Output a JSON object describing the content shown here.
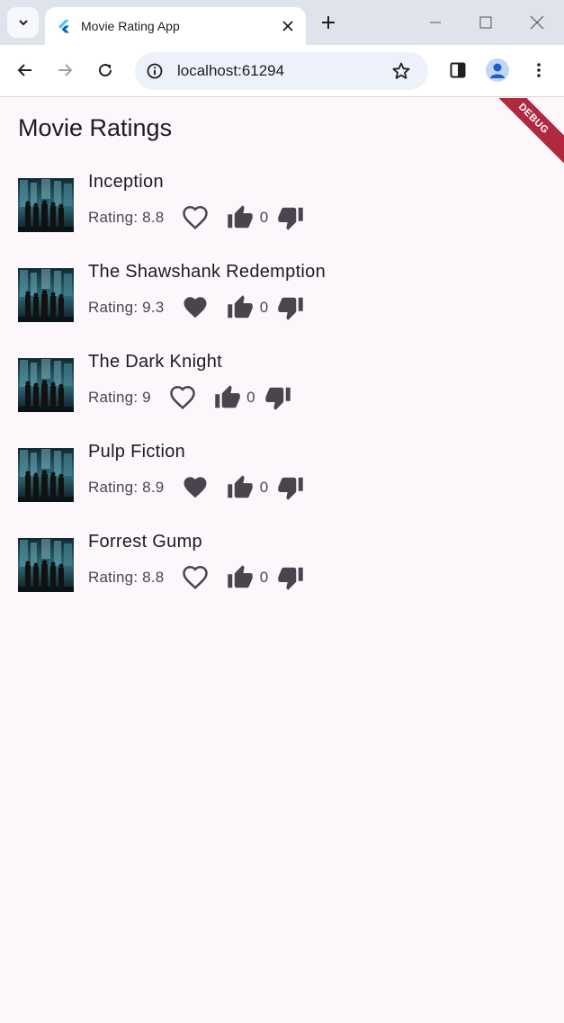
{
  "browser": {
    "tab_title": "Movie Rating App",
    "url": "localhost:61294"
  },
  "app": {
    "title": "Movie Ratings",
    "debug_banner": "DEBUG"
  },
  "movies": [
    {
      "title": "Inception",
      "rating": "Rating: 8.8",
      "favorite": false,
      "likes": "0"
    },
    {
      "title": "The Shawshank Redemption",
      "rating": "Rating: 9.3",
      "favorite": true,
      "likes": "0"
    },
    {
      "title": "The Dark Knight",
      "rating": "Rating: 9",
      "favorite": false,
      "likes": "0"
    },
    {
      "title": "Pulp Fiction",
      "rating": "Rating: 8.9",
      "favorite": true,
      "likes": "0"
    },
    {
      "title": "Forrest Gump",
      "rating": "Rating: 8.8",
      "favorite": false,
      "likes": "0"
    }
  ],
  "icons": {
    "heart_outline": "heart-outline-icon",
    "heart_filled": "heart-filled-icon",
    "thumb_up": "thumb-up-icon",
    "thumb_down": "thumb-down-icon"
  },
  "colors": {
    "background": "#fdf7fb",
    "icon": "#49454f",
    "debug": "#b0293e"
  }
}
